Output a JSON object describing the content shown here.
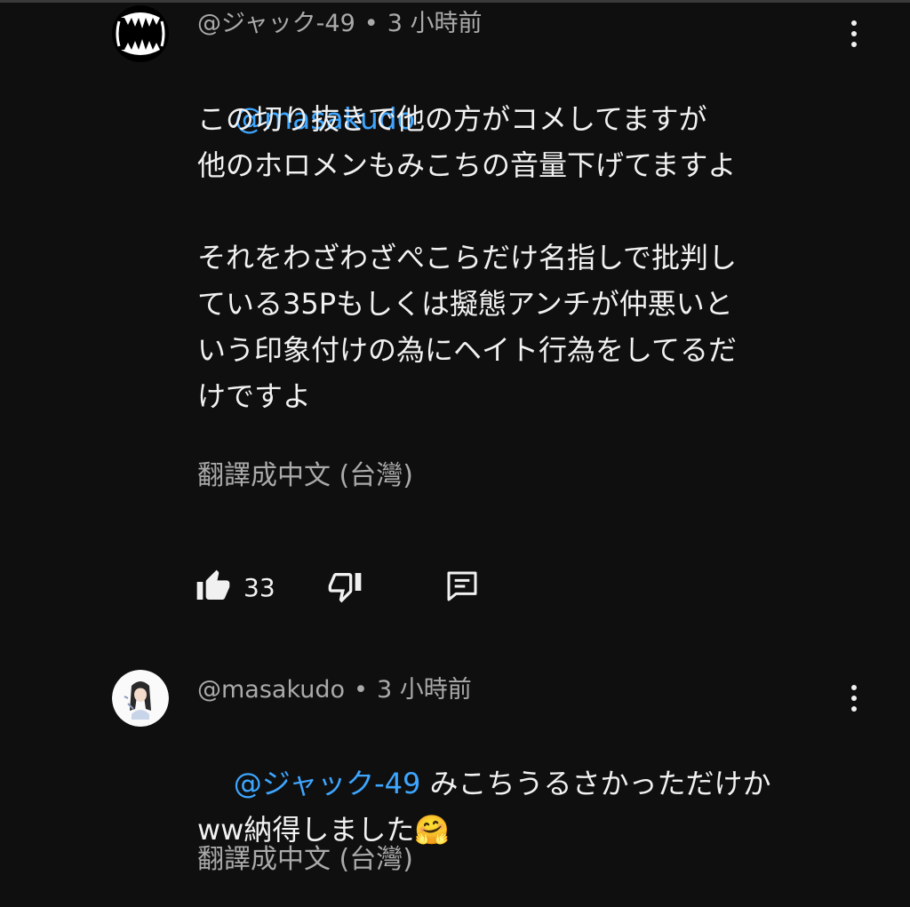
{
  "comments": [
    {
      "handle": "@ジャック-49",
      "separator": "•",
      "time": "3 小時前",
      "mention": "@masakudo",
      "text": "この切り抜きで他の方がコメしてますが\n他のホロメンもみこちの音量下げてますよ\n\nそれをわざわざぺこらだけ名指しで批判し\nている35Pもしくは擬態アンチが仲悪いと\nいう印象付けの為にヘイト行為をしてるだ\nけですよ",
      "translate_label": "翻譯成中文 (台灣)",
      "like_count": "33",
      "avatar_icon": "fangs-avatar-icon"
    },
    {
      "handle": "@masakudo",
      "separator": "•",
      "time": "3 小時前",
      "mention": "@ジャック-49",
      "text_line1_rest": " みこちうるさかっただけか",
      "text_line2": "ww納得しました",
      "emoji": "🤗",
      "translate_label": "翻譯成中文 (台灣)",
      "avatar_icon": "anime-girl-avatar-icon"
    }
  ],
  "colors": {
    "background": "#0f0f0f",
    "text": "#f1f1f1",
    "secondary": "#aaaaaa",
    "mention": "#3ea6ff"
  }
}
